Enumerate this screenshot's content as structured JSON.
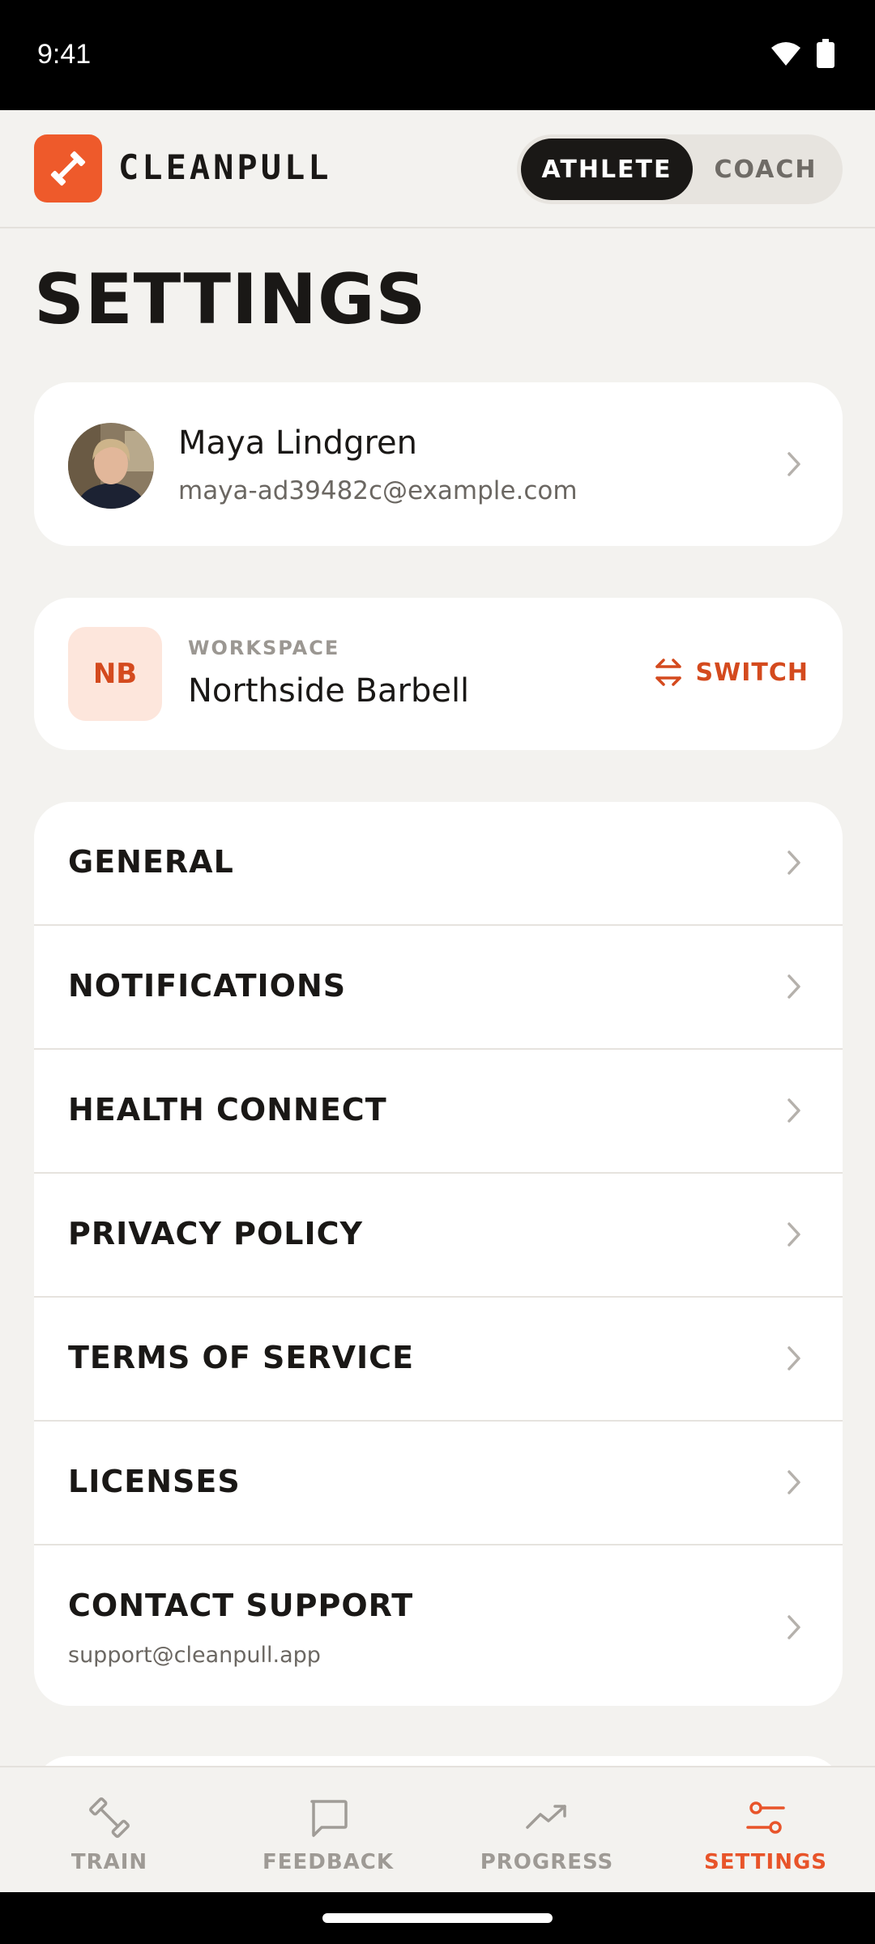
{
  "status_bar": {
    "time": "9:41"
  },
  "header": {
    "brand": "CLEANPULL",
    "modes": {
      "athlete": "ATHLETE",
      "coach": "COACH"
    },
    "active_mode": "athlete"
  },
  "page": {
    "title": "SETTINGS"
  },
  "profile": {
    "name": "Maya Lindgren",
    "email": "maya-ad39482c@example.com"
  },
  "workspace": {
    "label": "WORKSPACE",
    "initials": "NB",
    "name": "Northside Barbell",
    "switch_label": "SWITCH"
  },
  "menu": {
    "items": [
      {
        "label": "GENERAL"
      },
      {
        "label": "NOTIFICATIONS"
      },
      {
        "label": "HEALTH CONNECT"
      },
      {
        "label": "PRIVACY POLICY"
      },
      {
        "label": "TERMS OF SERVICE"
      },
      {
        "label": "LICENSES"
      },
      {
        "label": "CONTACT SUPPORT",
        "sublabel": "support@cleanpull.app"
      }
    ]
  },
  "bottom_nav": {
    "tabs": [
      {
        "label": "TRAIN",
        "icon": "dumbbell-icon"
      },
      {
        "label": "FEEDBACK",
        "icon": "chat-bubble-icon"
      },
      {
        "label": "PROGRESS",
        "icon": "trend-up-icon"
      },
      {
        "label": "SETTINGS",
        "icon": "sliders-icon"
      }
    ],
    "active": "SETTINGS"
  },
  "colors": {
    "accent": "#e8542a",
    "dark": "#1a1816",
    "background": "#f3f2ef"
  }
}
